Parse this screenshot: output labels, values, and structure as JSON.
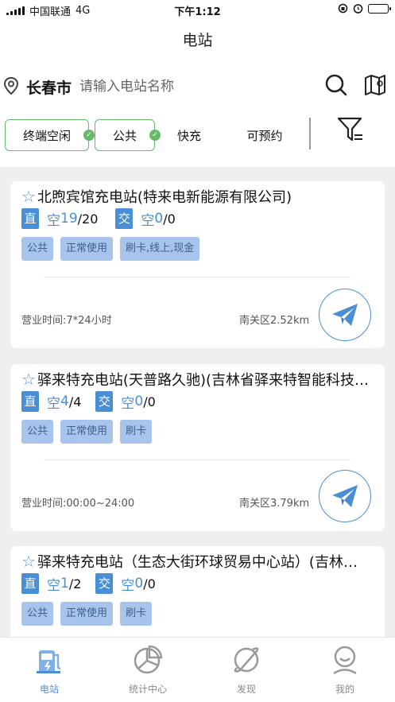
{
  "status_bar": {
    "carrier": "中国联通",
    "network": "4G",
    "time": "下午1:12"
  },
  "nav": {
    "title": "电站"
  },
  "search": {
    "city": "长春市",
    "placeholder": "请输入电站名称"
  },
  "filters": [
    {
      "label": "终端空闲",
      "active": true
    },
    {
      "label": "公共",
      "active": true
    },
    {
      "label": "快充",
      "active": false
    },
    {
      "label": "可预约",
      "active": false
    }
  ],
  "stations": [
    {
      "name": "北煦宾馆充电站(特来电新能源有限公司)",
      "dc_label": "直",
      "dc_free_prefix": "空",
      "dc_free": "19",
      "dc_total": "/20",
      "ac_label": "交",
      "ac_free_prefix": "空",
      "ac_free": "0",
      "ac_total": "/0",
      "tags": [
        "公共",
        "正常使用",
        "刷卡,线上,现金"
      ],
      "hours": "营业时间:7*24小时",
      "distance": "南关区2.52km"
    },
    {
      "name": "驿来特充电站(天普路久驰)(吉林省驿来特智能科技有限公司)",
      "dc_label": "直",
      "dc_free_prefix": "空",
      "dc_free": "4",
      "dc_total": "/4",
      "ac_label": "交",
      "ac_free_prefix": "空",
      "ac_free": "0",
      "ac_total": "/0",
      "tags": [
        "公共",
        "正常使用",
        "刷卡"
      ],
      "hours": "营业时间:00:00~24:00",
      "distance": "南关区3.79km"
    },
    {
      "name": "驿来特充电站（生态大街环球贸易中心站）(吉林省驿来特智能科技有限公司)",
      "dc_label": "直",
      "dc_free_prefix": "空",
      "dc_free": "1",
      "dc_total": "/2",
      "ac_label": "交",
      "ac_free_prefix": "空",
      "ac_free": "0",
      "ac_total": "/0",
      "tags": [
        "公共",
        "正常使用",
        "刷卡"
      ]
    }
  ],
  "tabbar": [
    {
      "label": "电站",
      "icon": "charging-station-icon",
      "active": true
    },
    {
      "label": "统计中心",
      "icon": "pie-chart-icon",
      "active": false
    },
    {
      "label": "发现",
      "icon": "planet-icon",
      "active": false
    },
    {
      "label": "我的",
      "icon": "user-icon",
      "active": false
    }
  ],
  "colors": {
    "accent": "#4a8fd6",
    "tag_bg": "#a8c4ec",
    "active_chip": "#66bb66",
    "page_bg": "#efeff1"
  }
}
